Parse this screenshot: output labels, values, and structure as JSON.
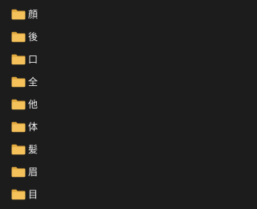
{
  "folders": [
    {
      "label": "顔",
      "icon": "folder-icon"
    },
    {
      "label": "後",
      "icon": "folder-icon"
    },
    {
      "label": "口",
      "icon": "folder-icon"
    },
    {
      "label": "全",
      "icon": "folder-icon"
    },
    {
      "label": "他",
      "icon": "folder-icon"
    },
    {
      "label": "体",
      "icon": "folder-icon"
    },
    {
      "label": "髪",
      "icon": "folder-icon"
    },
    {
      "label": "眉",
      "icon": "folder-icon"
    },
    {
      "label": "目",
      "icon": "folder-icon"
    }
  ],
  "colors": {
    "background": "#1c1c1c",
    "folder_front": "#f4c15a",
    "folder_back": "#e2a93e",
    "text": "#ececec"
  }
}
